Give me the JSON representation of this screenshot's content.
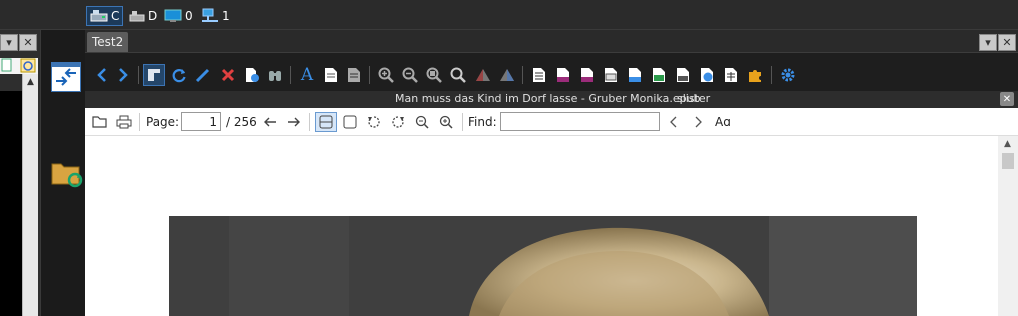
{
  "drives": [
    {
      "letter": "C",
      "icon": "drive-c-icon"
    },
    {
      "letter": "D",
      "icon": "drive-d-icon"
    },
    {
      "letter": "0",
      "icon": "monitor-icon"
    },
    {
      "letter": "1",
      "icon": "network-icon"
    }
  ],
  "tabs": [
    {
      "label": "Test2"
    }
  ],
  "titlebar": {
    "doc_title": "Man muss das Kind im Dorf lasse - Gruber Monika.epub",
    "app_label": "slister"
  },
  "viewer": {
    "page_label": "Page:",
    "page_value": "1",
    "page_total": "/ 256",
    "find_label": "Find:",
    "find_value": "",
    "font_size_label": "Aɑ"
  },
  "colors": {
    "accent": "#3c74b4",
    "dark_bg": "#1e1e1e",
    "toolbar_blue": "#3a8ee6"
  }
}
